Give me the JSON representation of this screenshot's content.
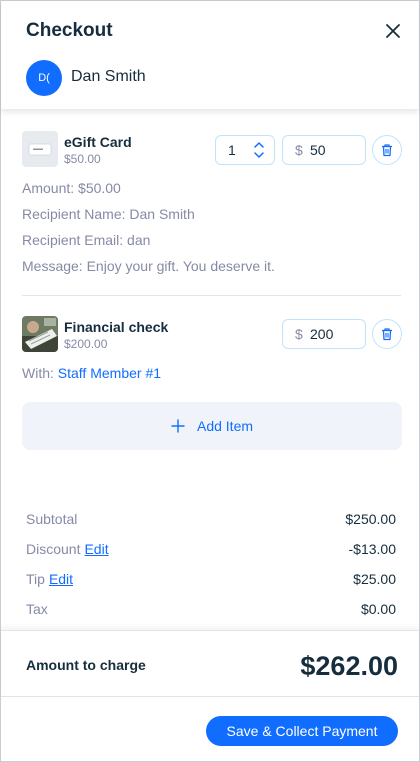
{
  "header": {
    "title": "Checkout",
    "customer": {
      "initials": "D(",
      "name": "Dan Smith"
    }
  },
  "items": [
    {
      "name": "eGift Card",
      "unit_price": "$50.00",
      "quantity": "1",
      "currency": "$",
      "price": "50",
      "details": {
        "amount": "Amount: $50.00",
        "recipient_name": "Recipient Name: Dan Smith",
        "recipient_email": "Recipient Email: dan",
        "message": "Message: Enjoy your gift. You deserve it."
      }
    },
    {
      "name": "Financial check",
      "unit_price": "$200.00",
      "currency": "$",
      "price": "200",
      "with_label": "With:",
      "staff": "Staff Member #1"
    }
  ],
  "add_item": {
    "label": "Add Item"
  },
  "summary": {
    "subtotal": {
      "label": "Subtotal",
      "value": "$250.00"
    },
    "discount": {
      "label": "Discount",
      "edit": "Edit",
      "value": "-$13.00"
    },
    "tip": {
      "label": "Tip",
      "edit": "Edit",
      "value": "$25.00"
    },
    "tax": {
      "label": "Tax",
      "value": "$0.00"
    }
  },
  "total": {
    "label": "Amount to charge",
    "value": "$262.00"
  },
  "actions": {
    "pay_label": "Save & Collect Payment"
  },
  "colors": {
    "accent": "#116dff",
    "text": "#162d3d",
    "muted": "#868aa5",
    "border": "#c1e4fe"
  }
}
